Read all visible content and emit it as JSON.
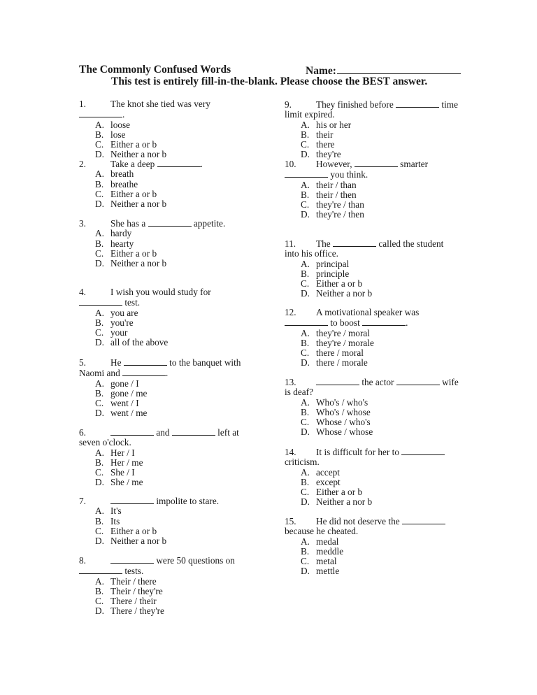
{
  "header": {
    "title": "The Commonly Confused Words",
    "name_label": "Name:",
    "instructions": "This test is entirely fill-in-the-blank. Please choose the BEST answer."
  },
  "questions": [
    {
      "number": "1.",
      "parts": [
        "The knot she tied was very ",
        "BLANK",
        "."
      ],
      "options": [
        {
          "letter": "A.",
          "text": "loose"
        },
        {
          "letter": "B.",
          "text": "lose"
        },
        {
          "letter": "C.",
          "text": "Either a or b"
        },
        {
          "letter": "D.",
          "text": "Neither a nor b"
        }
      ]
    },
    {
      "number": "2.",
      "parts": [
        "Take a deep ",
        "BLANK",
        "."
      ],
      "options": [
        {
          "letter": "A.",
          "text": "breath"
        },
        {
          "letter": "B.",
          "text": "breathe"
        },
        {
          "letter": "C.",
          "text": "Either a or b"
        },
        {
          "letter": "D.",
          "text": "Neither a nor b"
        }
      ]
    },
    {
      "number": "3.",
      "parts": [
        "She has a ",
        "BLANK",
        " appetite."
      ],
      "options": [
        {
          "letter": "A.",
          "text": "hardy"
        },
        {
          "letter": "B.",
          "text": "hearty"
        },
        {
          "letter": "C.",
          "text": "Either a or b"
        },
        {
          "letter": "D.",
          "text": "Neither a nor b"
        }
      ]
    },
    {
      "number": "4.",
      "parts": [
        "I wish you would study for ",
        "BLANK",
        " test."
      ],
      "options": [
        {
          "letter": "A.",
          "text": "you are"
        },
        {
          "letter": "B.",
          "text": "you're"
        },
        {
          "letter": "C.",
          "text": "your"
        },
        {
          "letter": "D.",
          "text": "all of the above"
        }
      ]
    },
    {
      "number": "5.",
      "parts": [
        "He ",
        "BLANK",
        " to the banquet with Naomi and ",
        "BLANK",
        "."
      ],
      "options": [
        {
          "letter": "A.",
          "text": "gone / I"
        },
        {
          "letter": "B.",
          "text": "gone / me"
        },
        {
          "letter": "C.",
          "text": "went / I"
        },
        {
          "letter": "D.",
          "text": "went / me"
        }
      ]
    },
    {
      "number": "6.",
      "parts": [
        "BLANK",
        " and ",
        "BLANK",
        " left at seven o'clock."
      ],
      "options": [
        {
          "letter": "A.",
          "text": "Her / I"
        },
        {
          "letter": "B.",
          "text": "Her / me"
        },
        {
          "letter": "C.",
          "text": "She / I"
        },
        {
          "letter": "D.",
          "text": "She / me"
        }
      ]
    },
    {
      "number": "7.",
      "parts": [
        "BLANK",
        " impolite to stare."
      ],
      "options": [
        {
          "letter": "A.",
          "text": "It's"
        },
        {
          "letter": "B.",
          "text": "Its"
        },
        {
          "letter": "C.",
          "text": "Either a or b"
        },
        {
          "letter": "D.",
          "text": "Neither a nor b"
        }
      ]
    },
    {
      "number": "8.",
      "parts": [
        "BLANK",
        " were 50 questions on ",
        "BLANK",
        " tests."
      ],
      "options": [
        {
          "letter": "A.",
          "text": "Their / there"
        },
        {
          "letter": "B.",
          "text": "Their / they're"
        },
        {
          "letter": "C.",
          "text": "There / their"
        },
        {
          "letter": "D.",
          "text": "There / they're"
        }
      ]
    },
    {
      "number": "9.",
      "parts": [
        "They finished before ",
        "BLANK",
        " time limit expired."
      ],
      "options": [
        {
          "letter": "A.",
          "text": "his or her"
        },
        {
          "letter": "B.",
          "text": "their"
        },
        {
          "letter": "C.",
          "text": "there"
        },
        {
          "letter": "D.",
          "text": "they're"
        }
      ]
    },
    {
      "number": "10.",
      "parts": [
        "However, ",
        "BLANK",
        " smarter ",
        "BLANK",
        " you think."
      ],
      "options": [
        {
          "letter": "A.",
          "text": "their / than"
        },
        {
          "letter": "B.",
          "text": "their / then"
        },
        {
          "letter": "C.",
          "text": "they're / than"
        },
        {
          "letter": "D.",
          "text": "they're / then"
        }
      ]
    },
    {
      "number": "11.",
      "parts": [
        "The ",
        "BLANK",
        " called the student into his office."
      ],
      "options": [
        {
          "letter": "A.",
          "text": "principal"
        },
        {
          "letter": "B.",
          "text": "principle"
        },
        {
          "letter": "C.",
          "text": "Either a or b"
        },
        {
          "letter": "D.",
          "text": "Neither a nor b"
        }
      ]
    },
    {
      "number": "12.",
      "parts": [
        "A motivational speaker was ",
        "BLANK",
        " to boost ",
        "BLANK",
        "."
      ],
      "options": [
        {
          "letter": "A.",
          "text": "they're / moral"
        },
        {
          "letter": "B.",
          "text": "they're / morale"
        },
        {
          "letter": "C.",
          "text": "there / moral"
        },
        {
          "letter": "D.",
          "text": "there / morale"
        }
      ]
    },
    {
      "number": "13.",
      "parts": [
        "BLANK",
        " the actor ",
        "BLANK",
        " wife is deaf?"
      ],
      "options": [
        {
          "letter": "A.",
          "text": "Who's / who's"
        },
        {
          "letter": "B.",
          "text": "Who's / whose"
        },
        {
          "letter": "C.",
          "text": "Whose / who's"
        },
        {
          "letter": "D.",
          "text": "Whose / whose"
        }
      ]
    },
    {
      "number": "14.",
      "parts": [
        "It is difficult for her to ",
        "BLANK",
        " criticism."
      ],
      "options": [
        {
          "letter": "A.",
          "text": "accept"
        },
        {
          "letter": "B.",
          "text": "except"
        },
        {
          "letter": "C.",
          "text": "Either a or b"
        },
        {
          "letter": "D.",
          "text": "Neither a nor b"
        }
      ]
    },
    {
      "number": "15.",
      "parts": [
        "He did not deserve the ",
        "BLANK",
        " because he cheated."
      ],
      "options": [
        {
          "letter": "A.",
          "text": "medal"
        },
        {
          "letter": "B.",
          "text": "meddle"
        },
        {
          "letter": "C.",
          "text": "metal"
        },
        {
          "letter": "D.",
          "text": "mettle"
        }
      ]
    }
  ]
}
